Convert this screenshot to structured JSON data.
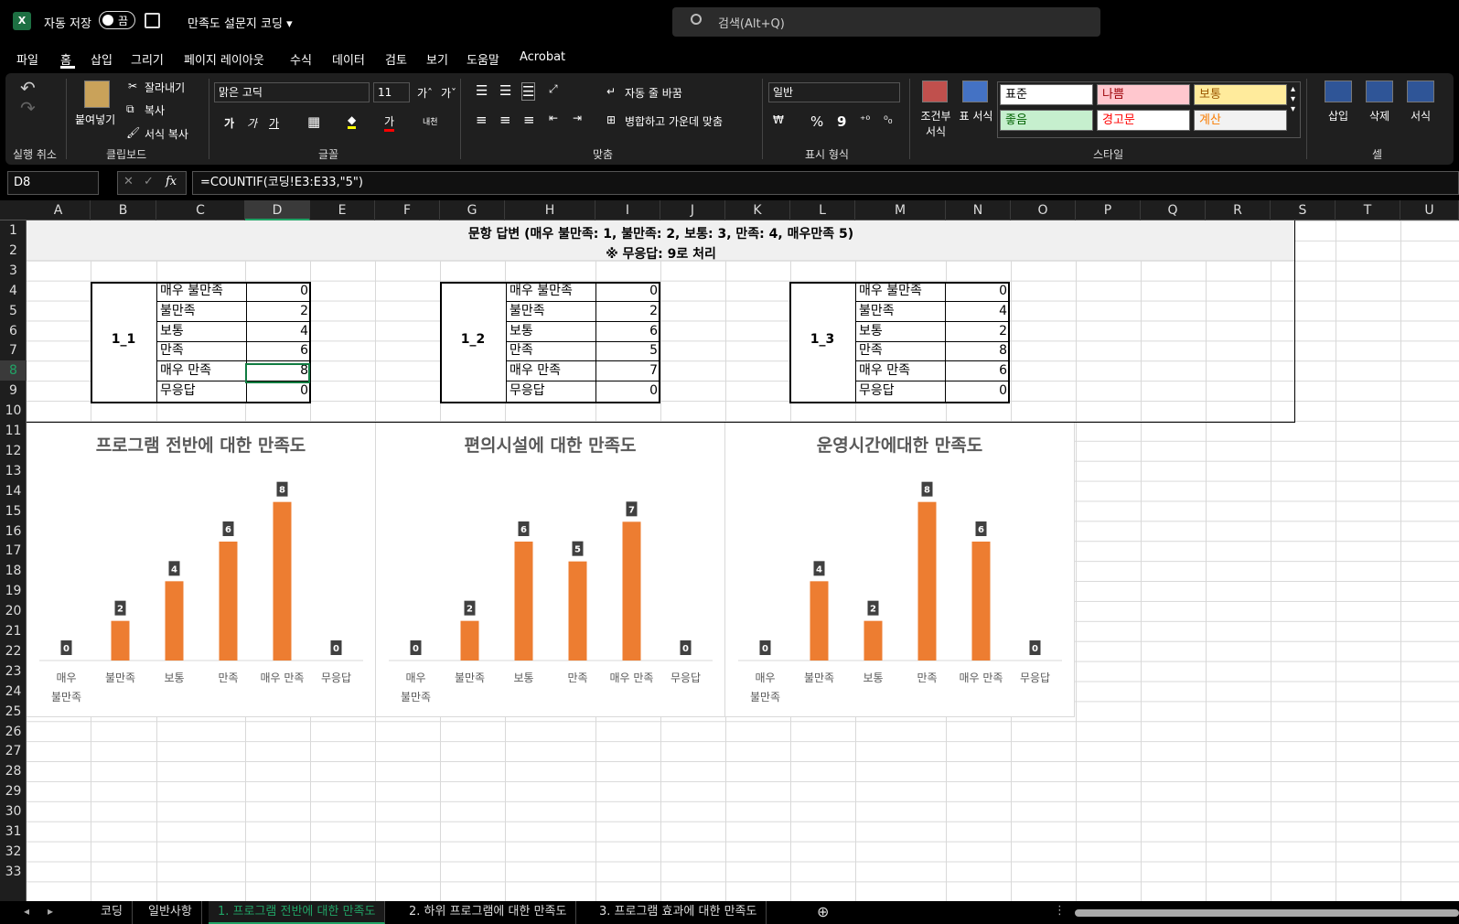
{
  "titlebar": {
    "autosave_label": "자동 저장",
    "autosave_state": "끔",
    "doc_title": "만족도 설문지 코딩 ▾",
    "search_placeholder": "검색(Alt+Q)"
  },
  "menu": [
    "파일",
    "홈",
    "삽입",
    "그리기",
    "페이지 레이아웃",
    "수식",
    "데이터",
    "검토",
    "보기",
    "도움말",
    "Acrobat"
  ],
  "ribbon": {
    "undo_group": "실행 취소",
    "clipboard": {
      "paste": "붙여넣기",
      "cut": "잘라내기",
      "copy": "복사",
      "format_painter": "서식 복사",
      "label": "클립보드"
    },
    "font": {
      "name": "맑은 고딕",
      "size": "11",
      "label": "글꼴",
      "grow": "가ˆ",
      "shrink": "가ˇ",
      "bold": "가",
      "italic": "가",
      "underline": "가",
      "color_a": "가",
      "phonetic": "내천"
    },
    "align": {
      "wrap": "자동 줄 바꿈",
      "merge": "병합하고 가운데 맞춤",
      "label": "맞춤"
    },
    "number": {
      "format": "일반",
      "percent": "%",
      "comma": "9",
      "label": "표시 형식"
    },
    "styles": {
      "cond": "조건부 서식",
      "table": "표 서식",
      "label": "스타일",
      "cells": [
        {
          "name": "표준",
          "bg": "#ffffff",
          "fg": "#000000"
        },
        {
          "name": "나쁨",
          "bg": "#ffc7ce",
          "fg": "#9c0006"
        },
        {
          "name": "보통",
          "bg": "#ffeb9c",
          "fg": "#9c5700"
        },
        {
          "name": "좋음",
          "bg": "#c6efce",
          "fg": "#006100"
        },
        {
          "name": "경고문",
          "bg": "#ffffff",
          "fg": "#ff0000"
        },
        {
          "name": "계산",
          "bg": "#f2f2f2",
          "fg": "#fa7d00"
        }
      ]
    },
    "cells": {
      "insert": "삽입",
      "delete": "삭제",
      "format": "서식",
      "label": "셀"
    }
  },
  "formula_bar": {
    "name_box": "D8",
    "formula": "=COUNTIF(코딩!E3:E33,\"5\")",
    "fx": "fx"
  },
  "columns": [
    "A",
    "B",
    "C",
    "D",
    "E",
    "F",
    "G",
    "H",
    "I",
    "J",
    "K",
    "L",
    "M",
    "N",
    "O",
    "P",
    "Q",
    "R",
    "S",
    "T",
    "U"
  ],
  "rows": [
    "1",
    "2",
    "3",
    "4",
    "5",
    "6",
    "7",
    "8",
    "9",
    "10",
    "11",
    "12",
    "13",
    "14",
    "15",
    "16",
    "17",
    "18",
    "19",
    "20",
    "21",
    "22",
    "23",
    "24",
    "25",
    "26",
    "27",
    "28",
    "29",
    "30",
    "31",
    "32",
    "33"
  ],
  "header": {
    "line1": "문항 답변 (매우 불만족: 1, 불만족: 2, 보통: 3, 만족: 4, 매우만족 5)",
    "line2": "※ 무응답: 9로 처리"
  },
  "tables": [
    {
      "id": "1_1",
      "rows": [
        [
          "매우 불만족",
          "0"
        ],
        [
          "불만족",
          "2"
        ],
        [
          "보통",
          "4"
        ],
        [
          "만족",
          "6"
        ],
        [
          "매우 만족",
          "8"
        ],
        [
          "무응답",
          "0"
        ]
      ]
    },
    {
      "id": "1_2",
      "rows": [
        [
          "매우 불만족",
          "0"
        ],
        [
          "불만족",
          "2"
        ],
        [
          "보통",
          "6"
        ],
        [
          "만족",
          "5"
        ],
        [
          "매우 만족",
          "7"
        ],
        [
          "무응답",
          "0"
        ]
      ]
    },
    {
      "id": "1_3",
      "rows": [
        [
          "매우 불만족",
          "0"
        ],
        [
          "불만족",
          "4"
        ],
        [
          "보통",
          "2"
        ],
        [
          "만족",
          "8"
        ],
        [
          "매우 만족",
          "6"
        ],
        [
          "무응답",
          "0"
        ]
      ]
    }
  ],
  "chart_data": [
    {
      "type": "bar",
      "title": "프로그램 전반에 대한 만족도",
      "categories": [
        "매우 불만족",
        "불만족",
        "보통",
        "만족",
        "매우 만족",
        "무응답"
      ],
      "values": [
        0,
        2,
        4,
        6,
        8,
        0
      ],
      "color": "#ed7d31",
      "ylim": [
        0,
        9
      ]
    },
    {
      "type": "bar",
      "title": "편의시설에 대한 만족도",
      "categories": [
        "매우 불만족",
        "불만족",
        "보통",
        "만족",
        "매우 만족",
        "무응답"
      ],
      "values": [
        0,
        2,
        6,
        5,
        7,
        0
      ],
      "color": "#ed7d31",
      "ylim": [
        0,
        9
      ]
    },
    {
      "type": "bar",
      "title": "운영시간에대한 만족도",
      "categories": [
        "매우 불만족",
        "불만족",
        "보통",
        "만족",
        "매우 만족",
        "무응답"
      ],
      "values": [
        0,
        4,
        2,
        8,
        6,
        0
      ],
      "color": "#ed7d31",
      "ylim": [
        0,
        9
      ]
    }
  ],
  "sheet_tabs": [
    "코딩",
    "일반사항",
    "1. 프로그램 전반에 대한 만족도",
    "2. 하위 프로그램에 대한 만족도",
    "3. 프로그램 효과에 대한 만족도"
  ],
  "active_tab": 2
}
